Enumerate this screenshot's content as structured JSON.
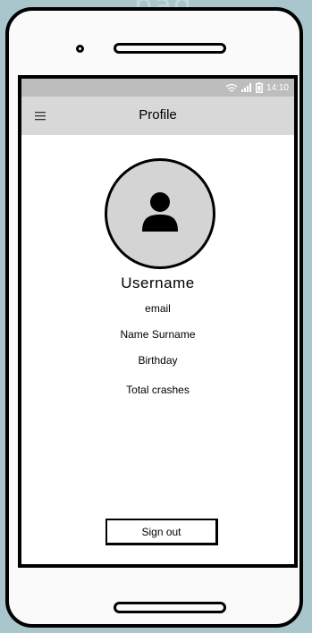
{
  "background": {
    "partial_title": "pag",
    "color": "#a9c6cc"
  },
  "status_bar": {
    "time": "14:10",
    "icons": [
      "wifi-icon",
      "signal-icon",
      "battery-icon"
    ]
  },
  "app_bar": {
    "title": "Profile",
    "menu_icon": "hamburger-menu-icon"
  },
  "profile": {
    "avatar_icon": "user-icon",
    "username": "Username",
    "email": "email",
    "name": "Name Surname",
    "birthday": "Birthday",
    "total_crashes": "Total crashes"
  },
  "actions": {
    "sign_out_label": "Sign out"
  }
}
